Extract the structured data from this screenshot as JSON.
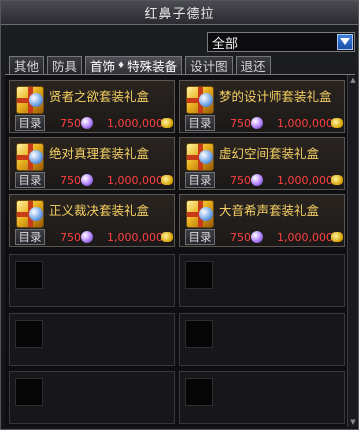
{
  "window": {
    "title": "红鼻子德拉"
  },
  "filter": {
    "selected": "全部"
  },
  "tabs": [
    {
      "label": "其他",
      "active": false
    },
    {
      "label": "防具",
      "active": false
    },
    {
      "label": "首饰",
      "active": true
    },
    {
      "label": "特殊装备",
      "active": true
    },
    {
      "label": "设计图",
      "active": false
    },
    {
      "label": "退还",
      "active": false
    }
  ],
  "catalog_label": "目录",
  "items": [
    {
      "name": "贤者之欲套装礼盒",
      "price": "750",
      "gold": "1,000,000"
    },
    {
      "name": "梦的设计师套装礼盒",
      "price": "750",
      "gold": "1,000,000"
    },
    {
      "name": "绝对真理套装礼盒",
      "price": "750",
      "gold": "1,000,000"
    },
    {
      "name": "虚幻空间套装礼盒",
      "price": "750",
      "gold": "1,000,000"
    },
    {
      "name": "正义裁决套装礼盒",
      "price": "750",
      "gold": "1,000,000"
    },
    {
      "name": "大音希声套装礼盒",
      "price": "750",
      "gold": "1,000,000"
    }
  ]
}
